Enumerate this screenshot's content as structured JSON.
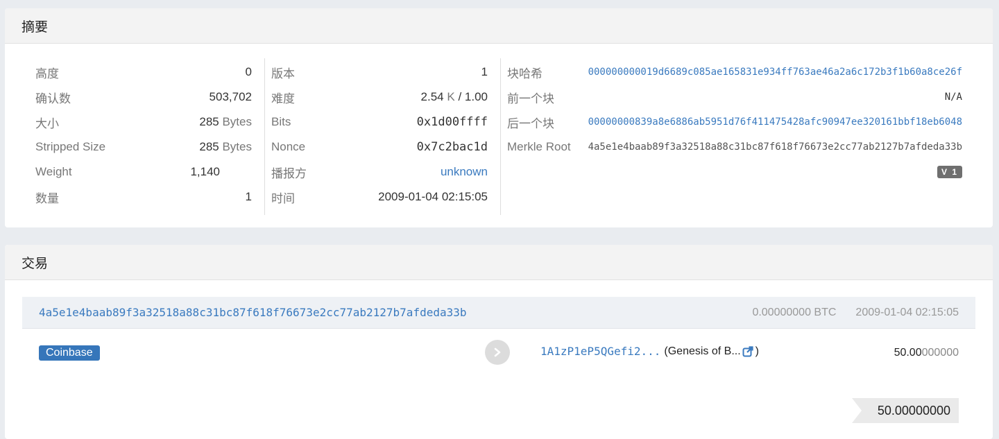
{
  "summary": {
    "title": "摘要",
    "c1": {
      "height_label": "高度",
      "height_value": "0",
      "confirm_label": "确认数",
      "confirm_value": "503,702",
      "size_label": "大小",
      "size_value": "285",
      "size_unit": "Bytes",
      "stripped_label": "Stripped Size",
      "stripped_value": "285",
      "stripped_unit": "Bytes",
      "weight_label": "Weight",
      "weight_value": "1,140",
      "count_label": "数量",
      "count_value": "1"
    },
    "c2": {
      "version_label": "版本",
      "version_value": "1",
      "difficulty_label": "难度",
      "difficulty_value": "2.54",
      "difficulty_unit": "K",
      "difficulty_suffix": "/ 1.00",
      "bits_label": "Bits",
      "bits_value": "0x1d00ffff",
      "nonce_label": "Nonce",
      "nonce_value": "0x7c2bac1d",
      "relay_label": "播报方",
      "relay_value": "unknown",
      "time_label": "时间",
      "time_value": "2009-01-04 02:15:05"
    },
    "c3": {
      "hash_label": "块哈希",
      "hash_value": "000000000019d6689c085ae165831e934ff763ae46a2a6c172b3f1b60a8ce26f",
      "prev_label": "前一个块",
      "prev_value": "N/A",
      "next_label": "后一个块",
      "next_value": "00000000839a8e6886ab5951d76f411475428afc90947ee320161bbf18eb6048",
      "merkle_label": "Merkle Root",
      "merkle_value": "4a5e1e4baab89f3a32518a88c31bc87f618f76673e2cc77ab2127b7afdeda33b",
      "version_badge": "V 1"
    }
  },
  "transactions": {
    "title": "交易",
    "tx": {
      "hash": "4a5e1e4baab89f3a32518a88c31bc87f618f76673e2cc77ab2127b7afdeda33b",
      "amount": "0.00000000 BTC",
      "time": "2009-01-04 02:15:05",
      "input_label": "Coinbase",
      "arrow_icon": "chevron-right-icon",
      "output_address": "1A1zP1eP5QGefi2...",
      "output_tag_open": "(Genesis of B...",
      "output_tag_close": ")",
      "output_value_main": "50.00",
      "output_value_dim": "000000",
      "total": "50.00000000"
    }
  },
  "colors": {
    "link": "#3a7abf",
    "badge": "#3676ba",
    "background": "#e9ecf0"
  }
}
